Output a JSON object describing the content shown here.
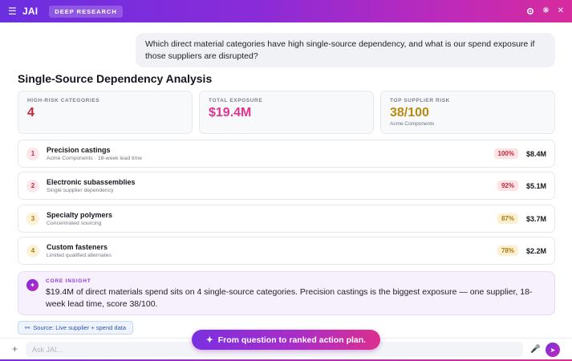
{
  "header": {
    "app_title": "JAI",
    "mode_badge": "DEEP RESEARCH",
    "icons": [
      "menu-icon",
      "settings-icon",
      "sun-icon",
      "close-icon"
    ]
  },
  "conversation": {
    "user_message": "Which direct material categories have high single-source dependency, and what is our spend exposure if those suppliers are disrupted?"
  },
  "analysis": {
    "title": "Single-Source Dependency Analysis",
    "kpis": [
      {
        "label": "HIGH-RISK CATEGORIES",
        "value": "4",
        "sub": "",
        "color": "#c0283a"
      },
      {
        "label": "TOTAL EXPOSURE",
        "value": "$19.4M",
        "sub": "",
        "color": "#e0338f"
      },
      {
        "label": "TOP SUPPLIER RISK",
        "value": "38/100",
        "sub": "Acme Components",
        "color": "#b88a12"
      }
    ],
    "items": [
      {
        "rank": "1",
        "title": "Precision castings",
        "sub": "Acme Components · 18-week lead time",
        "pct": "100%",
        "amount": "$8.4M",
        "rank_bg": "#fde7ea",
        "rank_fg": "#c0283a",
        "pct_bg": "#fde3e6",
        "pct_fg": "#c0283a"
      },
      {
        "rank": "2",
        "title": "Electronic subassemblies",
        "sub": "Single supplier dependency",
        "pct": "92%",
        "amount": "$5.1M",
        "rank_bg": "#fde7ea",
        "rank_fg": "#c0283a",
        "pct_bg": "#fde3e6",
        "pct_fg": "#c0283a"
      },
      {
        "rank": "3",
        "title": "Specialty polymers",
        "sub": "Concentrated sourcing",
        "pct": "87%",
        "amount": "$3.7M",
        "rank_bg": "#fdf2d8",
        "rank_fg": "#b07a0a",
        "pct_bg": "#fcf0d2",
        "pct_fg": "#b07a0a"
      },
      {
        "rank": "4",
        "title": "Custom fasteners",
        "sub": "Limited qualified alternates",
        "pct": "78%",
        "amount": "$2.2M",
        "rank_bg": "#fdf2d8",
        "rank_fg": "#b07a0a",
        "pct_bg": "#fcf0d2",
        "pct_fg": "#b07a0a"
      }
    ],
    "insight": {
      "label": "CORE INSIGHT",
      "text": "$19.4M of direct materials spend sits on 4 single-source categories. Precision castings is the biggest exposure — one supplier, 18-week lead time, score 38/100."
    },
    "source": {
      "label": "Source: Live supplier + spend data"
    }
  },
  "cta": {
    "label": "From question to ranked action plan."
  },
  "composer": {
    "placeholder": "Ask JAI..."
  },
  "colors": {
    "accent": "#7a2fe0",
    "accent_pink": "#dc2f8e"
  }
}
